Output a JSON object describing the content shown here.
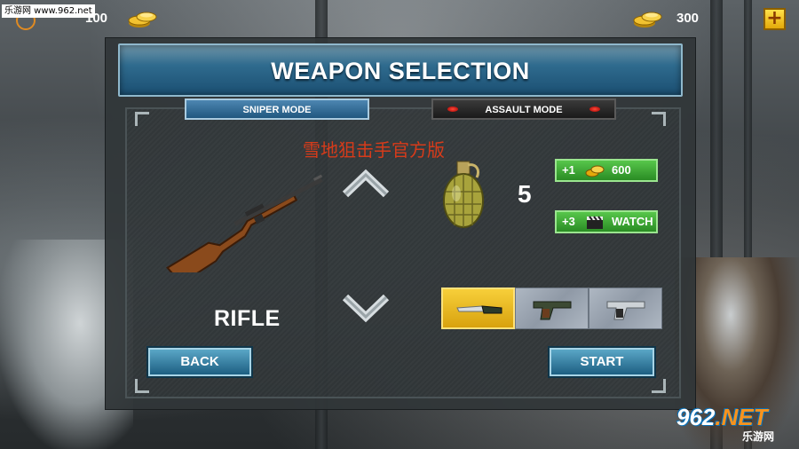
{
  "hud": {
    "watermark_text": "乐游网 www.962.net",
    "left_value": "100",
    "right_value": "300",
    "plus_label": "+"
  },
  "panel": {
    "title": "WEAPON SELECTION",
    "tabs": [
      {
        "label": "SNIPER MODE",
        "selected": true
      },
      {
        "label": "ASSAULT MODE",
        "selected": false
      }
    ],
    "overlay_text": "雪地狙击手官方版",
    "weapon_name": "RIFLE",
    "grenade_count": "5",
    "buy_coins": {
      "amount": "+1",
      "label": "600",
      "icon": "coin-icon"
    },
    "buy_watch": {
      "amount": "+3",
      "label": "WATCH",
      "icon": "clapperboard-icon"
    },
    "slots": [
      {
        "icon": "knife-icon",
        "selected": true
      },
      {
        "icon": "pistol-icon",
        "selected": false
      },
      {
        "icon": "pistol-silver-icon",
        "selected": false
      }
    ],
    "back_label": "BACK",
    "start_label": "START"
  },
  "logo": {
    "big_prefix": "962",
    "big_suffix": ".NET",
    "small": "乐游网"
  },
  "colors": {
    "header_blue": "#2f6b8e",
    "accent_green": "#2a8c24",
    "selected_slot_yellow": "#f7cf3a",
    "coin_gold": "#e3a90a"
  }
}
